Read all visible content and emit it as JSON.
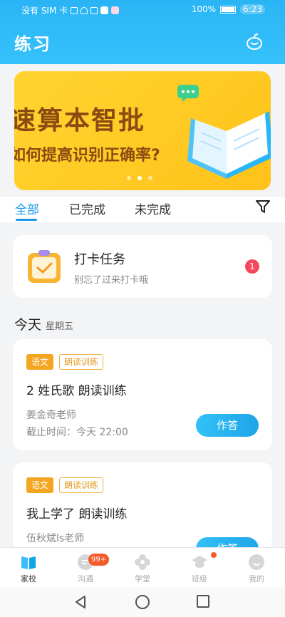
{
  "status_bar": {
    "carrier": "没有 SIM 卡",
    "battery": "100%",
    "time": "6:23"
  },
  "header": {
    "title": "练习",
    "action_icon": "fruit-icon"
  },
  "banner": {
    "headline": "速算本智批",
    "subline": "如何提高识别正确率?",
    "slides": 3,
    "active_slide": 2
  },
  "tabs": {
    "items": [
      "全部",
      "已完成",
      "未完成"
    ],
    "active": "全部",
    "filter_icon": "filter-icon"
  },
  "checkin": {
    "title": "打卡任务",
    "subtitle": "别忘了过来打卡哦",
    "badge": "1"
  },
  "section": {
    "day": "今天",
    "weekday": "星期五"
  },
  "tasks": [
    {
      "subject": "语文",
      "type": "朗读训练",
      "title": "2 姓氏歌 朗读训练",
      "teacher": "姜金奇老师",
      "deadline": "截止时间：今天 22:00",
      "button": "作答"
    },
    {
      "subject": "语文",
      "type": "朗读训练",
      "title": "我上学了 朗读训练",
      "teacher": "伍秋斌ls老师",
      "button": "作答"
    }
  ],
  "bottom_nav": {
    "items": [
      {
        "label": "家校",
        "icon": "book-icon",
        "active": true
      },
      {
        "label": "沟通",
        "icon": "chat-icon",
        "badge": "99+"
      },
      {
        "label": "学堂",
        "icon": "flower-icon"
      },
      {
        "label": "班级",
        "icon": "grad-cap-icon",
        "dot": true
      },
      {
        "label": "我的",
        "icon": "profile-icon"
      }
    ]
  },
  "colors": {
    "primary": "#1d9be8",
    "header": "#2ab4f5",
    "banner": "#ffc21a",
    "tag_orange": "#f4a623",
    "badge_red": "#f4495a"
  }
}
